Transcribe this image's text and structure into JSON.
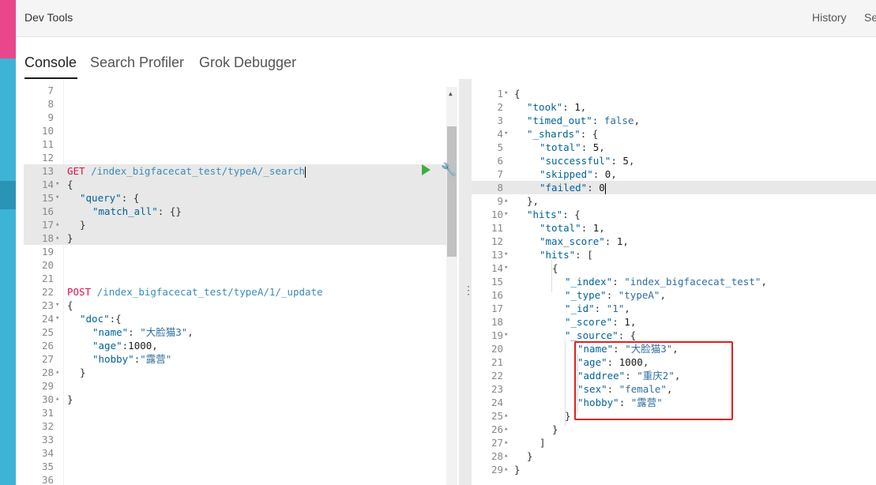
{
  "header": {
    "title": "Dev Tools",
    "history": "History",
    "settings": "Se"
  },
  "tabs": [
    "Console",
    "Search Profiler",
    "Grok Debugger"
  ],
  "editor": {
    "lines": [
      {
        "n": "7",
        "fold": "",
        "indent": 0,
        "tokens": []
      },
      {
        "n": "8",
        "fold": "",
        "indent": 0,
        "tokens": []
      },
      {
        "n": "9",
        "fold": "",
        "indent": 0,
        "tokens": []
      },
      {
        "n": "10",
        "fold": "",
        "indent": 0,
        "tokens": []
      },
      {
        "n": "11",
        "fold": "",
        "indent": 0,
        "tokens": []
      },
      {
        "n": "12",
        "fold": "",
        "indent": 0,
        "tokens": []
      },
      {
        "n": "13",
        "fold": "",
        "indent": 0,
        "hl": true,
        "tokens": [
          {
            "t": "GET ",
            "c": "m"
          },
          {
            "t": "/index_bigfacecat_test/typeA/_search",
            "c": "url"
          }
        ]
      },
      {
        "n": "14",
        "fold": "▾",
        "indent": 0,
        "hl": true,
        "tokens": [
          {
            "t": "{",
            "c": "p"
          }
        ]
      },
      {
        "n": "15",
        "fold": "▾",
        "indent": 1,
        "hl": true,
        "tokens": [
          {
            "t": "\"query\"",
            "c": "k"
          },
          {
            "t": ": {",
            "c": "p"
          }
        ]
      },
      {
        "n": "16",
        "fold": "",
        "indent": 2,
        "hl": true,
        "tokens": [
          {
            "t": "\"match_all\"",
            "c": "k"
          },
          {
            "t": ": {}",
            "c": "p"
          }
        ]
      },
      {
        "n": "17",
        "fold": "▴",
        "indent": 1,
        "hl": true,
        "tokens": [
          {
            "t": "}",
            "c": "p"
          }
        ]
      },
      {
        "n": "18",
        "fold": "▴",
        "indent": 0,
        "hl": true,
        "tokens": [
          {
            "t": "}",
            "c": "p"
          }
        ]
      },
      {
        "n": "19",
        "fold": "",
        "indent": 0,
        "tokens": []
      },
      {
        "n": "20",
        "fold": "",
        "indent": 0,
        "tokens": []
      },
      {
        "n": "21",
        "fold": "",
        "indent": 0,
        "tokens": []
      },
      {
        "n": "22",
        "fold": "",
        "indent": 0,
        "tokens": [
          {
            "t": "POST ",
            "c": "m"
          },
          {
            "t": "/index_bigfacecat_test/typeA/1/_update",
            "c": "url"
          }
        ]
      },
      {
        "n": "23",
        "fold": "▾",
        "indent": 0,
        "tokens": [
          {
            "t": "{",
            "c": "p"
          }
        ]
      },
      {
        "n": "24",
        "fold": "▾",
        "indent": 1,
        "tokens": [
          {
            "t": "\"doc\"",
            "c": "k"
          },
          {
            "t": ":{",
            "c": "p"
          }
        ]
      },
      {
        "n": "25",
        "fold": "",
        "indent": 2,
        "tokens": [
          {
            "t": "\"name\"",
            "c": "k"
          },
          {
            "t": ": ",
            "c": "p"
          },
          {
            "t": "\"大脸猫3\"",
            "c": "s"
          },
          {
            "t": ",",
            "c": "p"
          }
        ]
      },
      {
        "n": "26",
        "fold": "",
        "indent": 2,
        "tokens": [
          {
            "t": "\"age\"",
            "c": "k"
          },
          {
            "t": ":",
            "c": "p"
          },
          {
            "t": "1000",
            "c": "n"
          },
          {
            "t": ",",
            "c": "p"
          }
        ]
      },
      {
        "n": "27",
        "fold": "",
        "indent": 2,
        "tokens": [
          {
            "t": "\"hobby\"",
            "c": "k"
          },
          {
            "t": ":",
            "c": "p"
          },
          {
            "t": "\"露营\"",
            "c": "s"
          }
        ]
      },
      {
        "n": "28",
        "fold": "▴",
        "indent": 1,
        "tokens": [
          {
            "t": "}",
            "c": "p"
          }
        ]
      },
      {
        "n": "29",
        "fold": "",
        "indent": 0,
        "tokens": []
      },
      {
        "n": "30",
        "fold": "▴",
        "indent": 0,
        "tokens": [
          {
            "t": "}",
            "c": "p"
          }
        ]
      },
      {
        "n": "31",
        "fold": "",
        "indent": 0,
        "tokens": []
      },
      {
        "n": "32",
        "fold": "",
        "indent": 0,
        "tokens": []
      },
      {
        "n": "33",
        "fold": "",
        "indent": 0,
        "tokens": []
      },
      {
        "n": "34",
        "fold": "",
        "indent": 0,
        "tokens": []
      },
      {
        "n": "35",
        "fold": "",
        "indent": 0,
        "tokens": []
      },
      {
        "n": "36",
        "fold": "",
        "indent": 0,
        "tokens": []
      }
    ]
  },
  "output": {
    "lines": [
      {
        "n": "1",
        "fold": "▾",
        "indent": 0,
        "tokens": [
          {
            "t": "{",
            "c": "p"
          }
        ]
      },
      {
        "n": "2",
        "fold": "",
        "indent": 1,
        "tokens": [
          {
            "t": "\"took\"",
            "c": "k"
          },
          {
            "t": ": ",
            "c": "p"
          },
          {
            "t": "1",
            "c": "n"
          },
          {
            "t": ",",
            "c": "p"
          }
        ]
      },
      {
        "n": "3",
        "fold": "",
        "indent": 1,
        "tokens": [
          {
            "t": "\"timed_out\"",
            "c": "k"
          },
          {
            "t": ": ",
            "c": "p"
          },
          {
            "t": "false",
            "c": "b"
          },
          {
            "t": ",",
            "c": "p"
          }
        ]
      },
      {
        "n": "4",
        "fold": "▾",
        "indent": 1,
        "tokens": [
          {
            "t": "\"_shards\"",
            "c": "k"
          },
          {
            "t": ": {",
            "c": "p"
          }
        ]
      },
      {
        "n": "5",
        "fold": "",
        "indent": 2,
        "tokens": [
          {
            "t": "\"total\"",
            "c": "k"
          },
          {
            "t": ": ",
            "c": "p"
          },
          {
            "t": "5",
            "c": "n"
          },
          {
            "t": ",",
            "c": "p"
          }
        ]
      },
      {
        "n": "6",
        "fold": "",
        "indent": 2,
        "tokens": [
          {
            "t": "\"successful\"",
            "c": "k"
          },
          {
            "t": ": ",
            "c": "p"
          },
          {
            "t": "5",
            "c": "n"
          },
          {
            "t": ",",
            "c": "p"
          }
        ]
      },
      {
        "n": "7",
        "fold": "",
        "indent": 2,
        "tokens": [
          {
            "t": "\"skipped\"",
            "c": "k"
          },
          {
            "t": ": ",
            "c": "p"
          },
          {
            "t": "0",
            "c": "n"
          },
          {
            "t": ",",
            "c": "p"
          }
        ]
      },
      {
        "n": "8",
        "fold": "",
        "indent": 2,
        "hl": true,
        "tokens": [
          {
            "t": "\"failed\"",
            "c": "k"
          },
          {
            "t": ": ",
            "c": "p"
          },
          {
            "t": "0",
            "c": "n"
          }
        ]
      },
      {
        "n": "9",
        "fold": "▴",
        "indent": 1,
        "tokens": [
          {
            "t": "},",
            "c": "p"
          }
        ]
      },
      {
        "n": "10",
        "fold": "▾",
        "indent": 1,
        "tokens": [
          {
            "t": "\"hits\"",
            "c": "k"
          },
          {
            "t": ": {",
            "c": "p"
          }
        ]
      },
      {
        "n": "11",
        "fold": "",
        "indent": 2,
        "tokens": [
          {
            "t": "\"total\"",
            "c": "k"
          },
          {
            "t": ": ",
            "c": "p"
          },
          {
            "t": "1",
            "c": "n"
          },
          {
            "t": ",",
            "c": "p"
          }
        ]
      },
      {
        "n": "12",
        "fold": "",
        "indent": 2,
        "tokens": [
          {
            "t": "\"max_score\"",
            "c": "k"
          },
          {
            "t": ": ",
            "c": "p"
          },
          {
            "t": "1",
            "c": "n"
          },
          {
            "t": ",",
            "c": "p"
          }
        ]
      },
      {
        "n": "13",
        "fold": "▾",
        "indent": 2,
        "tokens": [
          {
            "t": "\"hits\"",
            "c": "k"
          },
          {
            "t": ": [",
            "c": "p"
          }
        ]
      },
      {
        "n": "14",
        "fold": "▾",
        "indent": 3,
        "tokens": [
          {
            "t": "{",
            "c": "p"
          }
        ]
      },
      {
        "n": "15",
        "fold": "",
        "indent": 4,
        "tokens": [
          {
            "t": "\"_index\"",
            "c": "k"
          },
          {
            "t": ": ",
            "c": "p"
          },
          {
            "t": "\"index_bigfacecat_test\"",
            "c": "s"
          },
          {
            "t": ",",
            "c": "p"
          }
        ]
      },
      {
        "n": "16",
        "fold": "",
        "indent": 4,
        "tokens": [
          {
            "t": "\"_type\"",
            "c": "k"
          },
          {
            "t": ": ",
            "c": "p"
          },
          {
            "t": "\"typeA\"",
            "c": "s"
          },
          {
            "t": ",",
            "c": "p"
          }
        ]
      },
      {
        "n": "17",
        "fold": "",
        "indent": 4,
        "tokens": [
          {
            "t": "\"_id\"",
            "c": "k"
          },
          {
            "t": ": ",
            "c": "p"
          },
          {
            "t": "\"1\"",
            "c": "s"
          },
          {
            "t": ",",
            "c": "p"
          }
        ]
      },
      {
        "n": "18",
        "fold": "",
        "indent": 4,
        "tokens": [
          {
            "t": "\"_score\"",
            "c": "k"
          },
          {
            "t": ": ",
            "c": "p"
          },
          {
            "t": "1",
            "c": "n"
          },
          {
            "t": ",",
            "c": "p"
          }
        ]
      },
      {
        "n": "19",
        "fold": "▾",
        "indent": 4,
        "tokens": [
          {
            "t": "\"_source\"",
            "c": "k"
          },
          {
            "t": ": {",
            "c": "p"
          }
        ]
      },
      {
        "n": "20",
        "fold": "",
        "indent": 5,
        "tokens": [
          {
            "t": "\"name\"",
            "c": "k"
          },
          {
            "t": ": ",
            "c": "p"
          },
          {
            "t": "\"大脸猫3\"",
            "c": "s"
          },
          {
            "t": ",",
            "c": "p"
          }
        ]
      },
      {
        "n": "21",
        "fold": "",
        "indent": 5,
        "tokens": [
          {
            "t": "\"age\"",
            "c": "k"
          },
          {
            "t": ": ",
            "c": "p"
          },
          {
            "t": "1000",
            "c": "n"
          },
          {
            "t": ",",
            "c": "p"
          }
        ]
      },
      {
        "n": "22",
        "fold": "",
        "indent": 5,
        "tokens": [
          {
            "t": "\"addree\"",
            "c": "k"
          },
          {
            "t": ": ",
            "c": "p"
          },
          {
            "t": "\"重庆2\"",
            "c": "s"
          },
          {
            "t": ",",
            "c": "p"
          }
        ]
      },
      {
        "n": "23",
        "fold": "",
        "indent": 5,
        "tokens": [
          {
            "t": "\"sex\"",
            "c": "k"
          },
          {
            "t": ": ",
            "c": "p"
          },
          {
            "t": "\"female\"",
            "c": "s"
          },
          {
            "t": ",",
            "c": "p"
          }
        ]
      },
      {
        "n": "24",
        "fold": "",
        "indent": 5,
        "tokens": [
          {
            "t": "\"hobby\"",
            "c": "k"
          },
          {
            "t": ": ",
            "c": "p"
          },
          {
            "t": "\"露营\"",
            "c": "s"
          }
        ]
      },
      {
        "n": "25",
        "fold": "▴",
        "indent": 4,
        "tokens": [
          {
            "t": "}",
            "c": "p"
          }
        ]
      },
      {
        "n": "26",
        "fold": "▴",
        "indent": 3,
        "tokens": [
          {
            "t": "}",
            "c": "p"
          }
        ]
      },
      {
        "n": "27",
        "fold": "▴",
        "indent": 2,
        "tokens": [
          {
            "t": "]",
            "c": "p"
          }
        ]
      },
      {
        "n": "28",
        "fold": "▴",
        "indent": 1,
        "tokens": [
          {
            "t": "}",
            "c": "p"
          }
        ]
      },
      {
        "n": "29",
        "fold": "▴",
        "indent": 0,
        "tokens": [
          {
            "t": "}",
            "c": "p"
          }
        ]
      }
    ]
  },
  "colors": {
    "accent_green": "#3daf3a",
    "method_red": "#d14",
    "highlight_box": "#e0201c"
  }
}
